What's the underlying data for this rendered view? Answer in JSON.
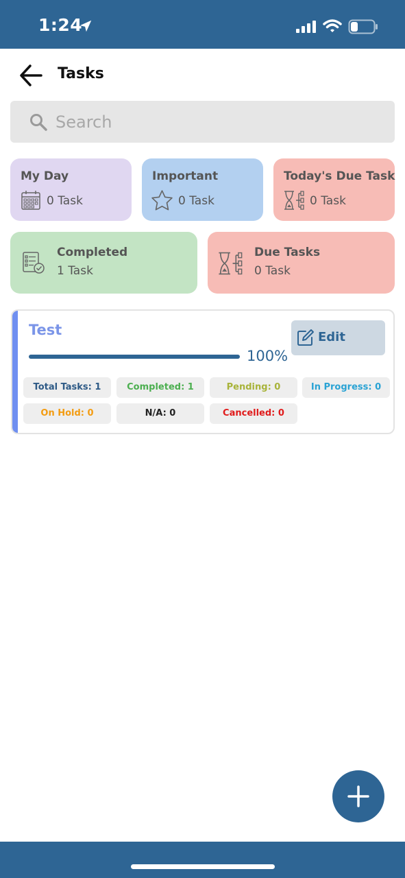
{
  "status_bar": {
    "time": "1:24"
  },
  "header": {
    "title": "Tasks"
  },
  "search": {
    "placeholder": "Search"
  },
  "cards": {
    "my_day": {
      "title": "My Day",
      "count": "0 Task",
      "color": "#e0d7f1"
    },
    "important": {
      "title": "Important",
      "count": "0 Task",
      "color": "#b3d0f0"
    },
    "todays_due": {
      "title": "Today's Due Task",
      "count": "0 Task",
      "color": "#f7bcb6"
    },
    "completed": {
      "title": "Completed",
      "count": "1 Task",
      "color": "#c3e4c4"
    },
    "due_tasks": {
      "title": "Due Tasks",
      "count": "0 Task",
      "color": "#f7bcb6"
    }
  },
  "project": {
    "title": "Test",
    "edit_label": "Edit",
    "progress_label": "100%",
    "progress_fraction": 1.0,
    "accent_color": "#6f8ff0",
    "stats": {
      "total": {
        "label": "Total Tasks: 1",
        "color": "#2e5a86"
      },
      "completed": {
        "label": "Completed: 1",
        "color": "#4caf50"
      },
      "pending": {
        "label": "Pending: 0",
        "color": "#a8b33a"
      },
      "in_progress": {
        "label": "In Progress: 0",
        "color": "#2aa3d4"
      },
      "on_hold": {
        "label": "On Hold: 0",
        "color": "#f39c12"
      },
      "na": {
        "label": "N/A: 0",
        "color": "#222222"
      },
      "cancelled": {
        "label": "Cancelled: 0",
        "color": "#e01b1b"
      }
    }
  },
  "theme": {
    "primary": "#2e6594"
  },
  "icons": {
    "status": [
      "location-arrow-icon",
      "signal-icon",
      "wifi-icon",
      "battery-icon"
    ],
    "header": "back-arrow-icon",
    "search": "search-icon",
    "cards": [
      "calendar-icon",
      "star-icon",
      "hourglass-tree-icon",
      "checklist-icon",
      "hourglass-tree-icon"
    ],
    "edit": "edit-icon",
    "fab": "plus-icon"
  }
}
